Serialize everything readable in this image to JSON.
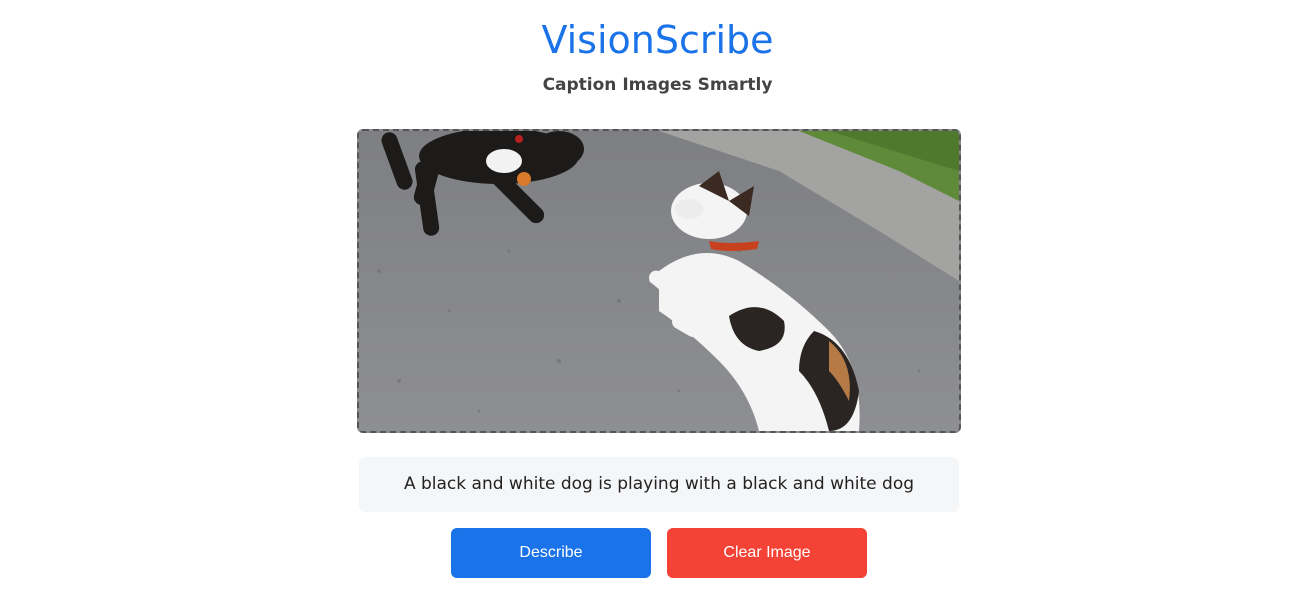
{
  "header": {
    "title": "VisionScribe",
    "subtitle": "Caption Images Smartly"
  },
  "image_panel": {
    "image_description_icon": "photo-of-two-dogs-on-road"
  },
  "caption": {
    "text": "A black and white dog is playing with a black and white dog"
  },
  "actions": {
    "describe_label": "Describe",
    "clear_label": "Clear Image"
  },
  "colors": {
    "title": "#1a73e8",
    "describe_button": "#1a73e8",
    "clear_button": "#f44336",
    "caption_background": "#f5f6f8"
  }
}
